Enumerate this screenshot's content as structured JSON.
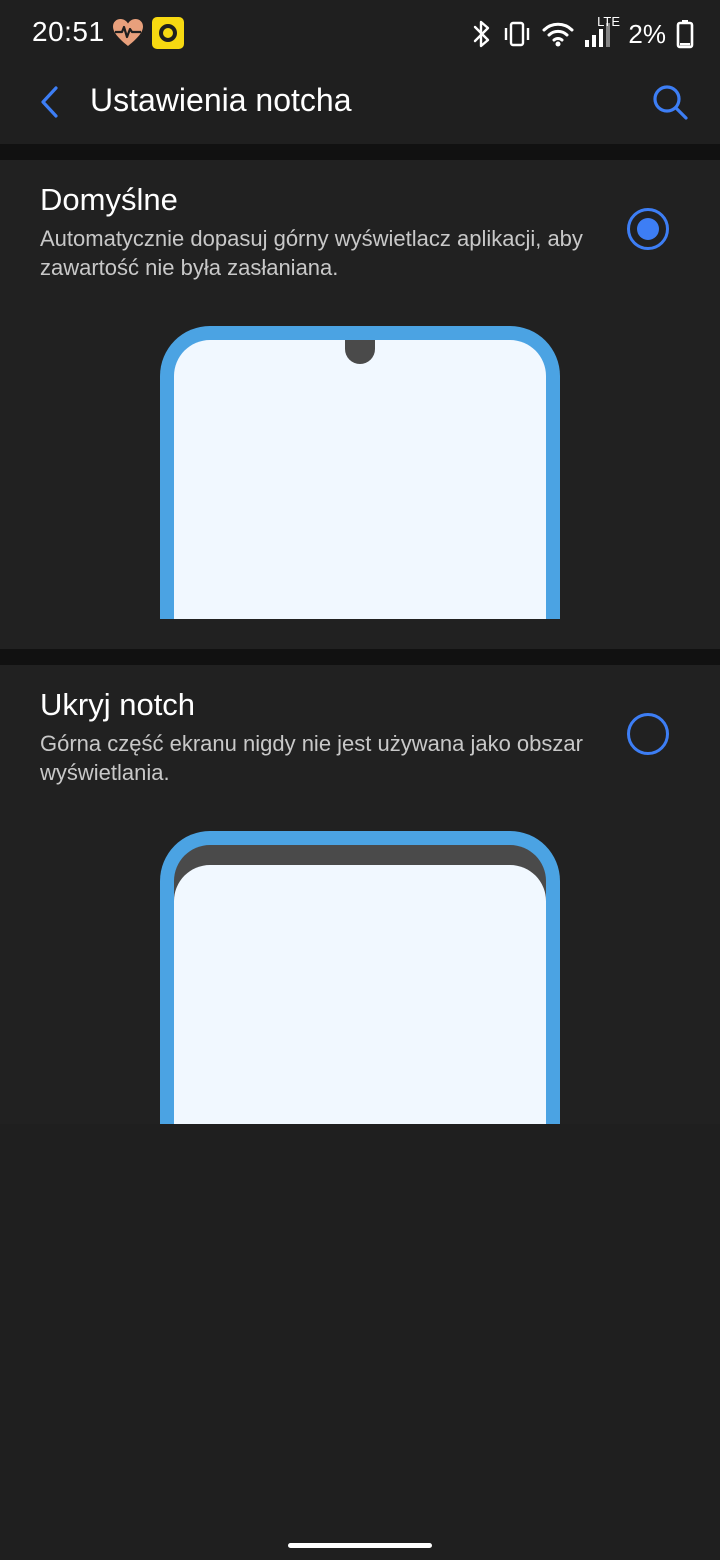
{
  "status_bar": {
    "time": "20:51",
    "network": "LTE",
    "battery": "2%",
    "icons": [
      "heart-rate-icon",
      "app-circle-icon",
      "bluetooth-icon",
      "vibrate-icon",
      "wifi-icon",
      "signal-icon",
      "battery-icon"
    ]
  },
  "app_bar": {
    "title": "Ustawienia notcha",
    "back_icon": "chevron-left-icon",
    "search_icon": "search-icon"
  },
  "options": [
    {
      "title": "Domyślne",
      "description": "Automatycznie dopasuj górny wyświetlacz aplikacji, aby zawartość nie była zasłaniana.",
      "selected": true
    },
    {
      "title": "Ukryj notch",
      "description": "Górna część ekranu nigdy nie jest używana jako obszar wyświetlania.",
      "selected": false
    }
  ],
  "colors": {
    "background": "#1f1f1f",
    "accent": "#3d7ef5",
    "phone_frame": "#4ba3e3",
    "phone_screen": "#f1f8ff",
    "notch": "#4a4a4a"
  }
}
